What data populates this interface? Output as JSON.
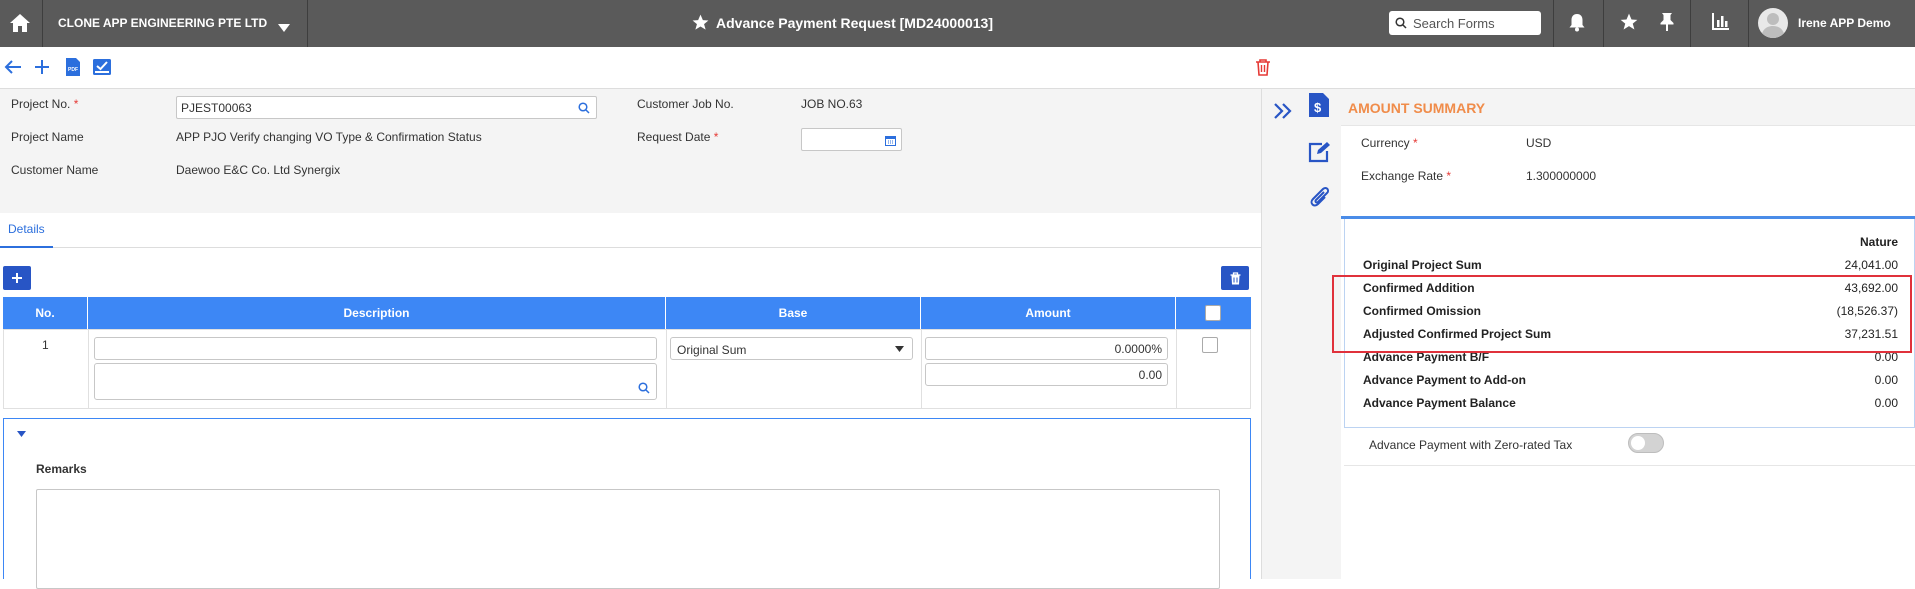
{
  "topbar": {
    "company": "CLONE APP ENGINEERING PTE LTD",
    "page_title": "Advance Payment Request [MD24000013]",
    "search_placeholder": "Search Forms",
    "user_name": "Irene APP Demo"
  },
  "header": {
    "project_no_label": "Project No.",
    "project_no_value": "PJEST00063",
    "project_name_label": "Project Name",
    "project_name_value": "APP PJO Verify changing VO Type & Confirmation Status",
    "customer_name_label": "Customer Name",
    "customer_name_value": "Daewoo E&C Co. Ltd Synergix",
    "customer_job_label": "Customer Job No.",
    "customer_job_value": "JOB NO.63",
    "request_date_label": "Request Date",
    "request_date_value": ""
  },
  "tabs": [
    {
      "label": "Details"
    }
  ],
  "grid": {
    "columns": [
      "No.",
      "Description",
      "Base",
      "Amount"
    ],
    "rows": [
      {
        "no": "1",
        "description": "",
        "description2": "",
        "base": "Original Sum",
        "amount_pct": "0.0000%",
        "amount": "0.00"
      }
    ]
  },
  "remarks": {
    "label": "Remarks",
    "value": ""
  },
  "summary": {
    "title": "AMOUNT SUMMARY",
    "currency_label": "Currency",
    "currency_value": "USD",
    "exchange_label": "Exchange Rate",
    "exchange_value": "1.300000000",
    "nature_header": "Nature",
    "rows": [
      {
        "label": "Original Project Sum",
        "value": "24,041.00"
      },
      {
        "label": "Confirmed Addition",
        "value": "43,692.00"
      },
      {
        "label": "Confirmed Omission",
        "value": "(18,526.37)"
      },
      {
        "label": "Adjusted Confirmed Project Sum",
        "value": "37,231.51"
      },
      {
        "label": "Advance Payment B/F",
        "value": "0.00"
      },
      {
        "label": "Advance Payment to Add-on",
        "value": "0.00"
      },
      {
        "label": "Advance Payment Balance",
        "value": "0.00"
      }
    ],
    "zero_rated_label": "Advance Payment with Zero-rated Tax",
    "zero_rated_on": false
  },
  "colors": {
    "topbar": "#5a5a5a",
    "accent": "#2855c5",
    "grid_header": "#3d87f5",
    "summary_title": "#f08c4a",
    "highlight": "#e0313b",
    "delete": "#e53935"
  }
}
